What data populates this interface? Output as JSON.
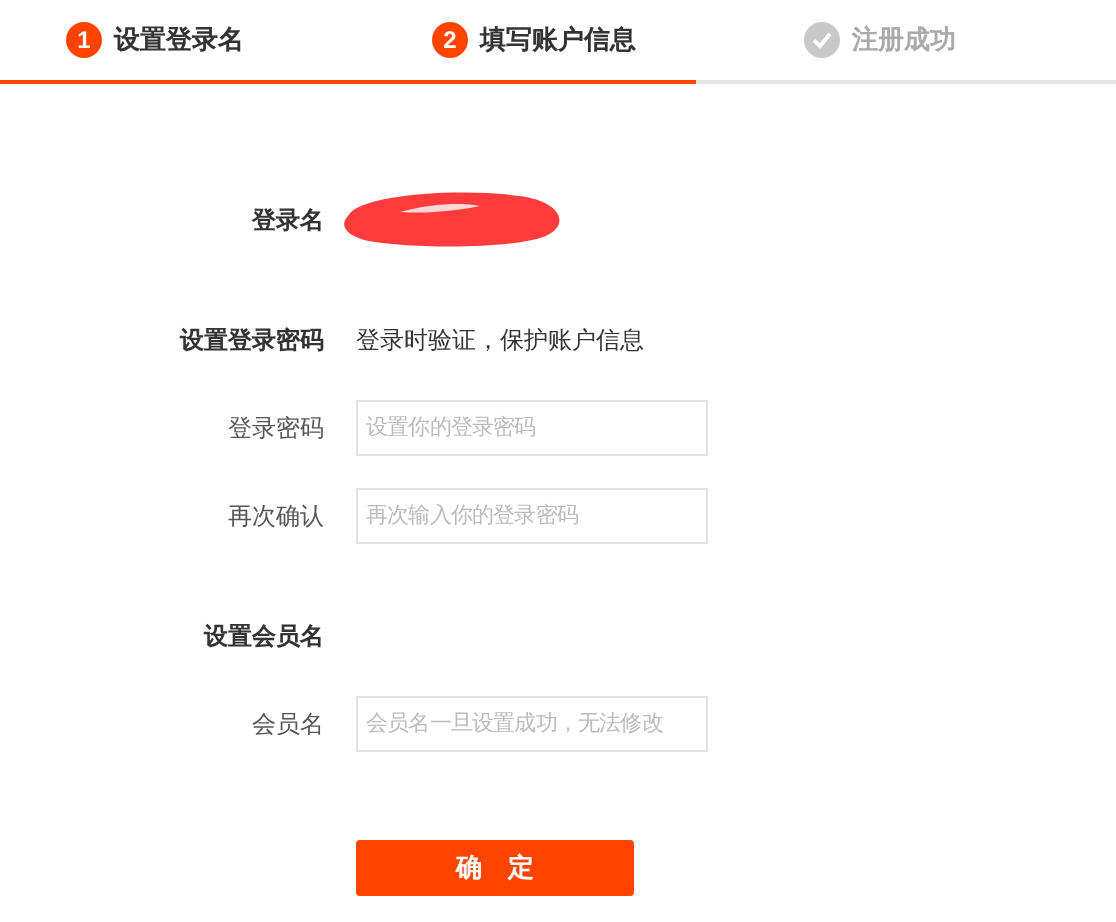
{
  "steps": [
    {
      "kind": "numbered",
      "number": "1",
      "label": "设置登录名",
      "active": true
    },
    {
      "kind": "numbered",
      "number": "2",
      "label": "填写账户信息",
      "active": true
    },
    {
      "kind": "check",
      "label": "注册成功",
      "active": false
    }
  ],
  "rows": [
    {
      "kind": "redacted",
      "label": "登录名"
    },
    {
      "kind": "heading",
      "label": "设置登录密码",
      "note": "登录时验证，保护账户信息"
    },
    {
      "kind": "field",
      "label": "登录密码",
      "placeholder": "设置你的登录密码"
    },
    {
      "kind": "field",
      "label": "再次确认",
      "placeholder": "再次输入你的登录密码"
    },
    {
      "kind": "heading",
      "label": "设置会员名"
    },
    {
      "kind": "field",
      "label": "会员名",
      "placeholder": "会员名一旦设置成功，无法修改"
    }
  ],
  "submit": "确　定"
}
